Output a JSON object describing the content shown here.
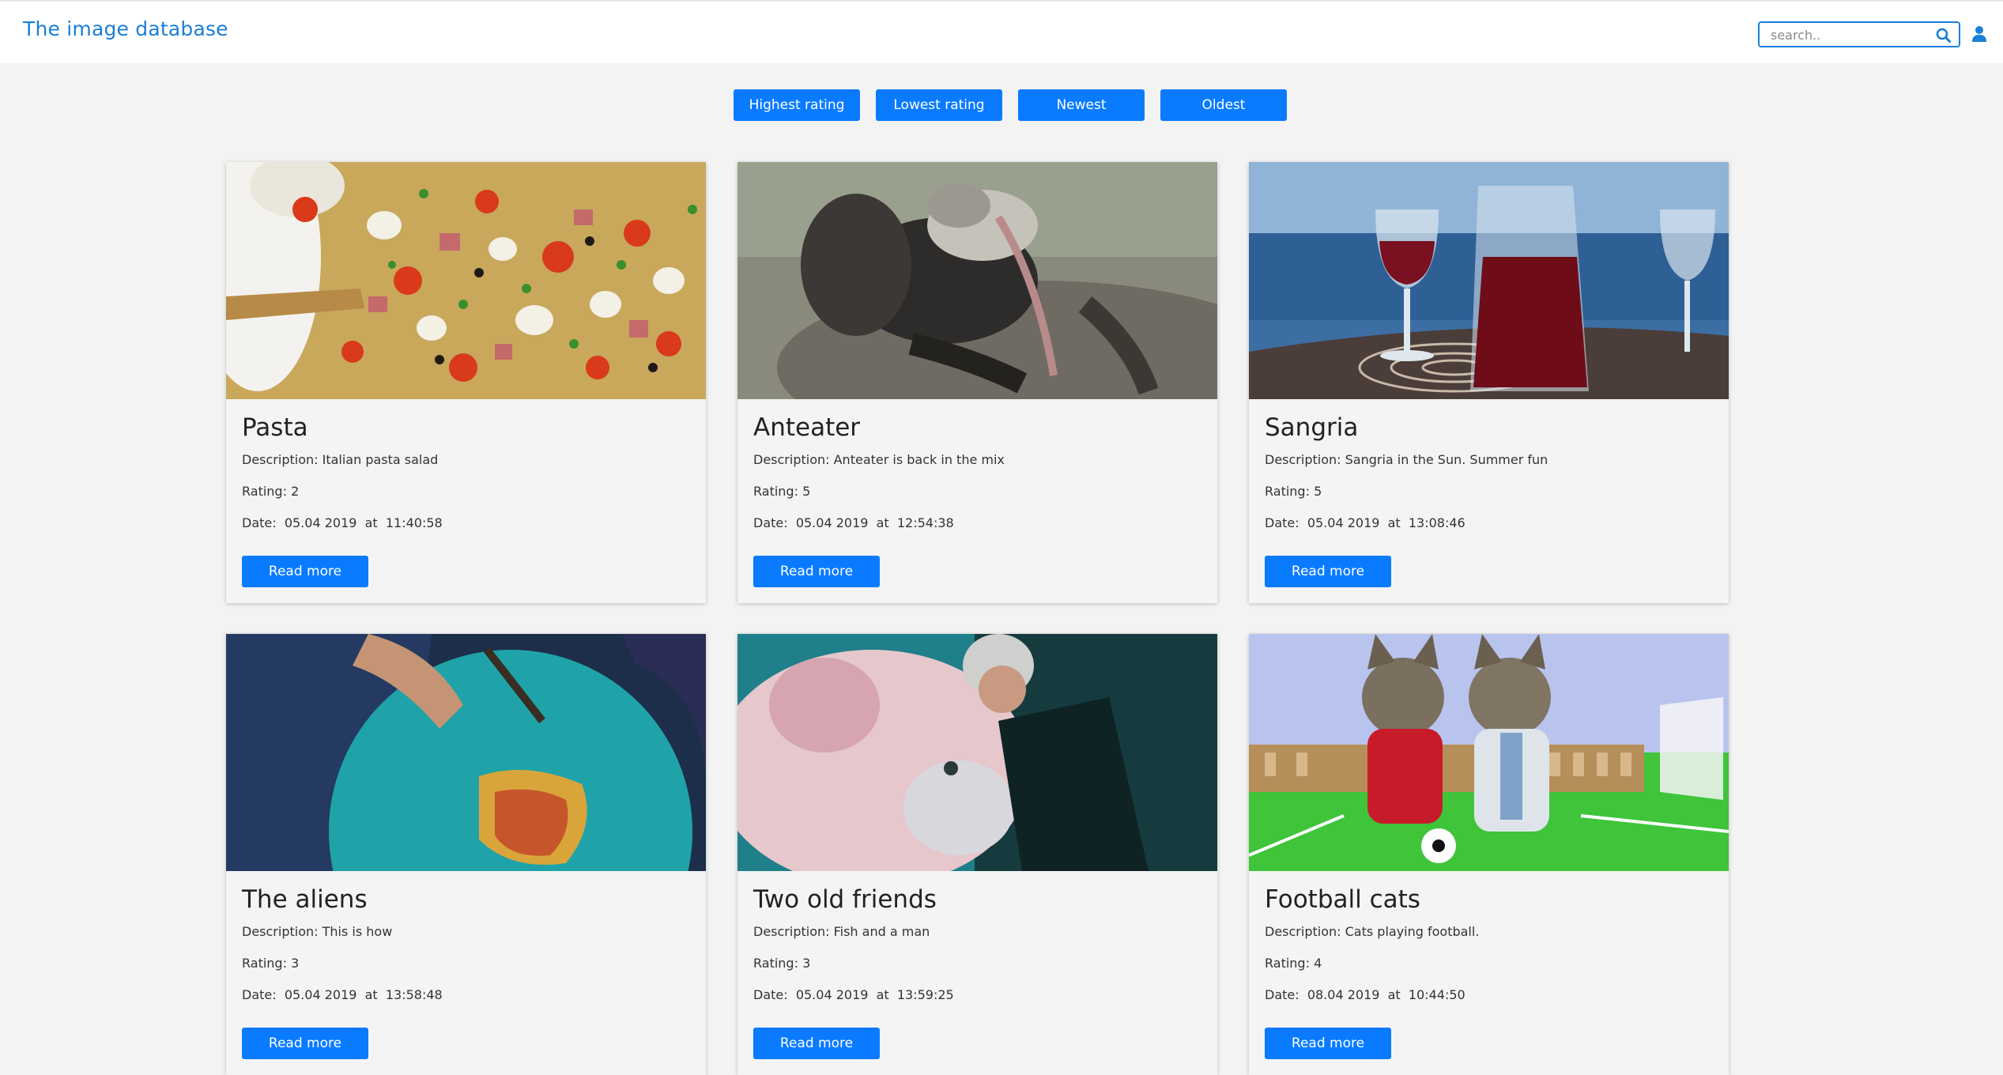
{
  "header": {
    "brand": "The image database",
    "search_placeholder": "search..",
    "search_icon": "search-icon",
    "user_icon": "user-icon",
    "accent": "#1a7fd8"
  },
  "sort_buttons": [
    "Highest rating",
    "Lowest rating",
    "Newest",
    "Oldest"
  ],
  "button_color": "#0a7bff",
  "cards": [
    {
      "title": "Pasta",
      "description_label": "Description:",
      "description": "Italian pasta salad",
      "rating_label": "Rating:",
      "rating": "2",
      "date_label": "Date:",
      "date": "05.04 2019",
      "at_label": "at",
      "time": "11:40:58",
      "button": "Read more",
      "image": "pasta-salad-photo"
    },
    {
      "title": "Anteater",
      "description_label": "Description:",
      "description": "Anteater is back in the mix",
      "rating_label": "Rating:",
      "rating": "5",
      "date_label": "Date:",
      "date": "05.04 2019",
      "at_label": "at",
      "time": "12:54:38",
      "button": "Read more",
      "image": "anteater-photo"
    },
    {
      "title": "Sangria",
      "description_label": "Description:",
      "description": "Sangria in the Sun. Summer fun",
      "rating_label": "Rating:",
      "rating": "5",
      "date_label": "Date:",
      "date": "05.04 2019",
      "at_label": "at",
      "time": "13:08:46",
      "button": "Read more",
      "image": "sangria-photo"
    },
    {
      "title": "The aliens",
      "description_label": "Description:",
      "description": "This is how",
      "rating_label": "Rating:",
      "rating": "3",
      "date_label": "Date:",
      "date": "05.04 2019",
      "at_label": "at",
      "time": "13:58:48",
      "button": "Read more",
      "image": "globe-painting-photo"
    },
    {
      "title": "Two old friends",
      "description_label": "Description:",
      "description": "Fish and a man",
      "rating_label": "Rating:",
      "rating": "3",
      "date_label": "Date:",
      "date": "05.04 2019",
      "at_label": "at",
      "time": "13:59:25",
      "button": "Read more",
      "image": "fish-and-diver-photo"
    },
    {
      "title": "Football cats",
      "description_label": "Description:",
      "description": "Cats playing football.",
      "rating_label": "Rating:",
      "rating": "4",
      "date_label": "Date:",
      "date": "08.04 2019",
      "at_label": "at",
      "time": "10:44:50",
      "button": "Read more",
      "image": "football-cats-photo"
    }
  ]
}
